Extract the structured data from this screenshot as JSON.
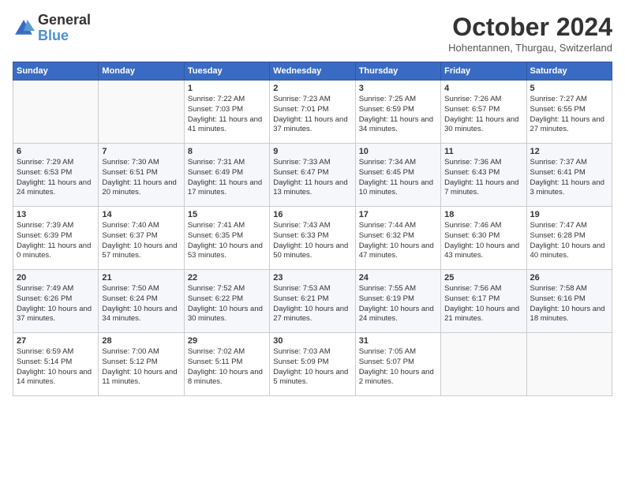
{
  "header": {
    "logo_line1": "General",
    "logo_line2": "Blue",
    "month": "October 2024",
    "location": "Hohentannen, Thurgau, Switzerland"
  },
  "days_of_week": [
    "Sunday",
    "Monday",
    "Tuesday",
    "Wednesday",
    "Thursday",
    "Friday",
    "Saturday"
  ],
  "weeks": [
    [
      {
        "day": "",
        "sunrise": "",
        "sunset": "",
        "daylight": ""
      },
      {
        "day": "",
        "sunrise": "",
        "sunset": "",
        "daylight": ""
      },
      {
        "day": "1",
        "sunrise": "Sunrise: 7:22 AM",
        "sunset": "Sunset: 7:03 PM",
        "daylight": "Daylight: 11 hours and 41 minutes."
      },
      {
        "day": "2",
        "sunrise": "Sunrise: 7:23 AM",
        "sunset": "Sunset: 7:01 PM",
        "daylight": "Daylight: 11 hours and 37 minutes."
      },
      {
        "day": "3",
        "sunrise": "Sunrise: 7:25 AM",
        "sunset": "Sunset: 6:59 PM",
        "daylight": "Daylight: 11 hours and 34 minutes."
      },
      {
        "day": "4",
        "sunrise": "Sunrise: 7:26 AM",
        "sunset": "Sunset: 6:57 PM",
        "daylight": "Daylight: 11 hours and 30 minutes."
      },
      {
        "day": "5",
        "sunrise": "Sunrise: 7:27 AM",
        "sunset": "Sunset: 6:55 PM",
        "daylight": "Daylight: 11 hours and 27 minutes."
      }
    ],
    [
      {
        "day": "6",
        "sunrise": "Sunrise: 7:29 AM",
        "sunset": "Sunset: 6:53 PM",
        "daylight": "Daylight: 11 hours and 24 minutes."
      },
      {
        "day": "7",
        "sunrise": "Sunrise: 7:30 AM",
        "sunset": "Sunset: 6:51 PM",
        "daylight": "Daylight: 11 hours and 20 minutes."
      },
      {
        "day": "8",
        "sunrise": "Sunrise: 7:31 AM",
        "sunset": "Sunset: 6:49 PM",
        "daylight": "Daylight: 11 hours and 17 minutes."
      },
      {
        "day": "9",
        "sunrise": "Sunrise: 7:33 AM",
        "sunset": "Sunset: 6:47 PM",
        "daylight": "Daylight: 11 hours and 13 minutes."
      },
      {
        "day": "10",
        "sunrise": "Sunrise: 7:34 AM",
        "sunset": "Sunset: 6:45 PM",
        "daylight": "Daylight: 11 hours and 10 minutes."
      },
      {
        "day": "11",
        "sunrise": "Sunrise: 7:36 AM",
        "sunset": "Sunset: 6:43 PM",
        "daylight": "Daylight: 11 hours and 7 minutes."
      },
      {
        "day": "12",
        "sunrise": "Sunrise: 7:37 AM",
        "sunset": "Sunset: 6:41 PM",
        "daylight": "Daylight: 11 hours and 3 minutes."
      }
    ],
    [
      {
        "day": "13",
        "sunrise": "Sunrise: 7:39 AM",
        "sunset": "Sunset: 6:39 PM",
        "daylight": "Daylight: 11 hours and 0 minutes."
      },
      {
        "day": "14",
        "sunrise": "Sunrise: 7:40 AM",
        "sunset": "Sunset: 6:37 PM",
        "daylight": "Daylight: 10 hours and 57 minutes."
      },
      {
        "day": "15",
        "sunrise": "Sunrise: 7:41 AM",
        "sunset": "Sunset: 6:35 PM",
        "daylight": "Daylight: 10 hours and 53 minutes."
      },
      {
        "day": "16",
        "sunrise": "Sunrise: 7:43 AM",
        "sunset": "Sunset: 6:33 PM",
        "daylight": "Daylight: 10 hours and 50 minutes."
      },
      {
        "day": "17",
        "sunrise": "Sunrise: 7:44 AM",
        "sunset": "Sunset: 6:32 PM",
        "daylight": "Daylight: 10 hours and 47 minutes."
      },
      {
        "day": "18",
        "sunrise": "Sunrise: 7:46 AM",
        "sunset": "Sunset: 6:30 PM",
        "daylight": "Daylight: 10 hours and 43 minutes."
      },
      {
        "day": "19",
        "sunrise": "Sunrise: 7:47 AM",
        "sunset": "Sunset: 6:28 PM",
        "daylight": "Daylight: 10 hours and 40 minutes."
      }
    ],
    [
      {
        "day": "20",
        "sunrise": "Sunrise: 7:49 AM",
        "sunset": "Sunset: 6:26 PM",
        "daylight": "Daylight: 10 hours and 37 minutes."
      },
      {
        "day": "21",
        "sunrise": "Sunrise: 7:50 AM",
        "sunset": "Sunset: 6:24 PM",
        "daylight": "Daylight: 10 hours and 34 minutes."
      },
      {
        "day": "22",
        "sunrise": "Sunrise: 7:52 AM",
        "sunset": "Sunset: 6:22 PM",
        "daylight": "Daylight: 10 hours and 30 minutes."
      },
      {
        "day": "23",
        "sunrise": "Sunrise: 7:53 AM",
        "sunset": "Sunset: 6:21 PM",
        "daylight": "Daylight: 10 hours and 27 minutes."
      },
      {
        "day": "24",
        "sunrise": "Sunrise: 7:55 AM",
        "sunset": "Sunset: 6:19 PM",
        "daylight": "Daylight: 10 hours and 24 minutes."
      },
      {
        "day": "25",
        "sunrise": "Sunrise: 7:56 AM",
        "sunset": "Sunset: 6:17 PM",
        "daylight": "Daylight: 10 hours and 21 minutes."
      },
      {
        "day": "26",
        "sunrise": "Sunrise: 7:58 AM",
        "sunset": "Sunset: 6:16 PM",
        "daylight": "Daylight: 10 hours and 18 minutes."
      }
    ],
    [
      {
        "day": "27",
        "sunrise": "Sunrise: 6:59 AM",
        "sunset": "Sunset: 5:14 PM",
        "daylight": "Daylight: 10 hours and 14 minutes."
      },
      {
        "day": "28",
        "sunrise": "Sunrise: 7:00 AM",
        "sunset": "Sunset: 5:12 PM",
        "daylight": "Daylight: 10 hours and 11 minutes."
      },
      {
        "day": "29",
        "sunrise": "Sunrise: 7:02 AM",
        "sunset": "Sunset: 5:11 PM",
        "daylight": "Daylight: 10 hours and 8 minutes."
      },
      {
        "day": "30",
        "sunrise": "Sunrise: 7:03 AM",
        "sunset": "Sunset: 5:09 PM",
        "daylight": "Daylight: 10 hours and 5 minutes."
      },
      {
        "day": "31",
        "sunrise": "Sunrise: 7:05 AM",
        "sunset": "Sunset: 5:07 PM",
        "daylight": "Daylight: 10 hours and 2 minutes."
      },
      {
        "day": "",
        "sunrise": "",
        "sunset": "",
        "daylight": ""
      },
      {
        "day": "",
        "sunrise": "",
        "sunset": "",
        "daylight": ""
      }
    ]
  ]
}
